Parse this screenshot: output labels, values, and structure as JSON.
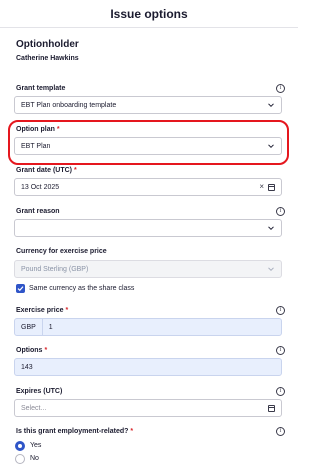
{
  "header": {
    "title": "Issue options"
  },
  "optionholder": {
    "section_title": "Optionholder",
    "name": "Catherine Hawkins"
  },
  "fields": {
    "grant_template": {
      "label": "Grant template",
      "value": "EBT Plan onboarding template"
    },
    "option_plan": {
      "label": "Option plan",
      "required_mark": "*",
      "value": "EBT Plan"
    },
    "grant_date": {
      "label": "Grant date (UTC)",
      "required_mark": "*",
      "value": "13 Oct 2025",
      "clear_symbol": "×"
    },
    "grant_reason": {
      "label": "Grant reason",
      "value": ""
    },
    "currency": {
      "label": "Currency for exercise price",
      "value": "Pound Sterling (GBP)"
    },
    "same_currency": {
      "label": "Same currency as the share class",
      "checked": true
    },
    "exercise_price": {
      "label": "Exercise price",
      "required_mark": "*",
      "currency_prefix": "GBP",
      "value": "1"
    },
    "options": {
      "label": "Options",
      "required_mark": "*",
      "value": "143"
    },
    "expires": {
      "label": "Expires (UTC)",
      "placeholder": "Select..."
    },
    "employment_related": {
      "label": "Is this grant employment-related?",
      "required_mark": "*",
      "choices": [
        "Yes",
        "No"
      ],
      "selected": "Yes"
    }
  },
  "icons": {
    "info": "info-icon",
    "chevron": "chevron-down-icon",
    "calendar": "calendar-icon",
    "check": "check-icon"
  },
  "colors": {
    "accent": "#2f55c8",
    "highlight": "#e5171e",
    "required": "#d9262b",
    "input_blue": "#e8effd"
  }
}
